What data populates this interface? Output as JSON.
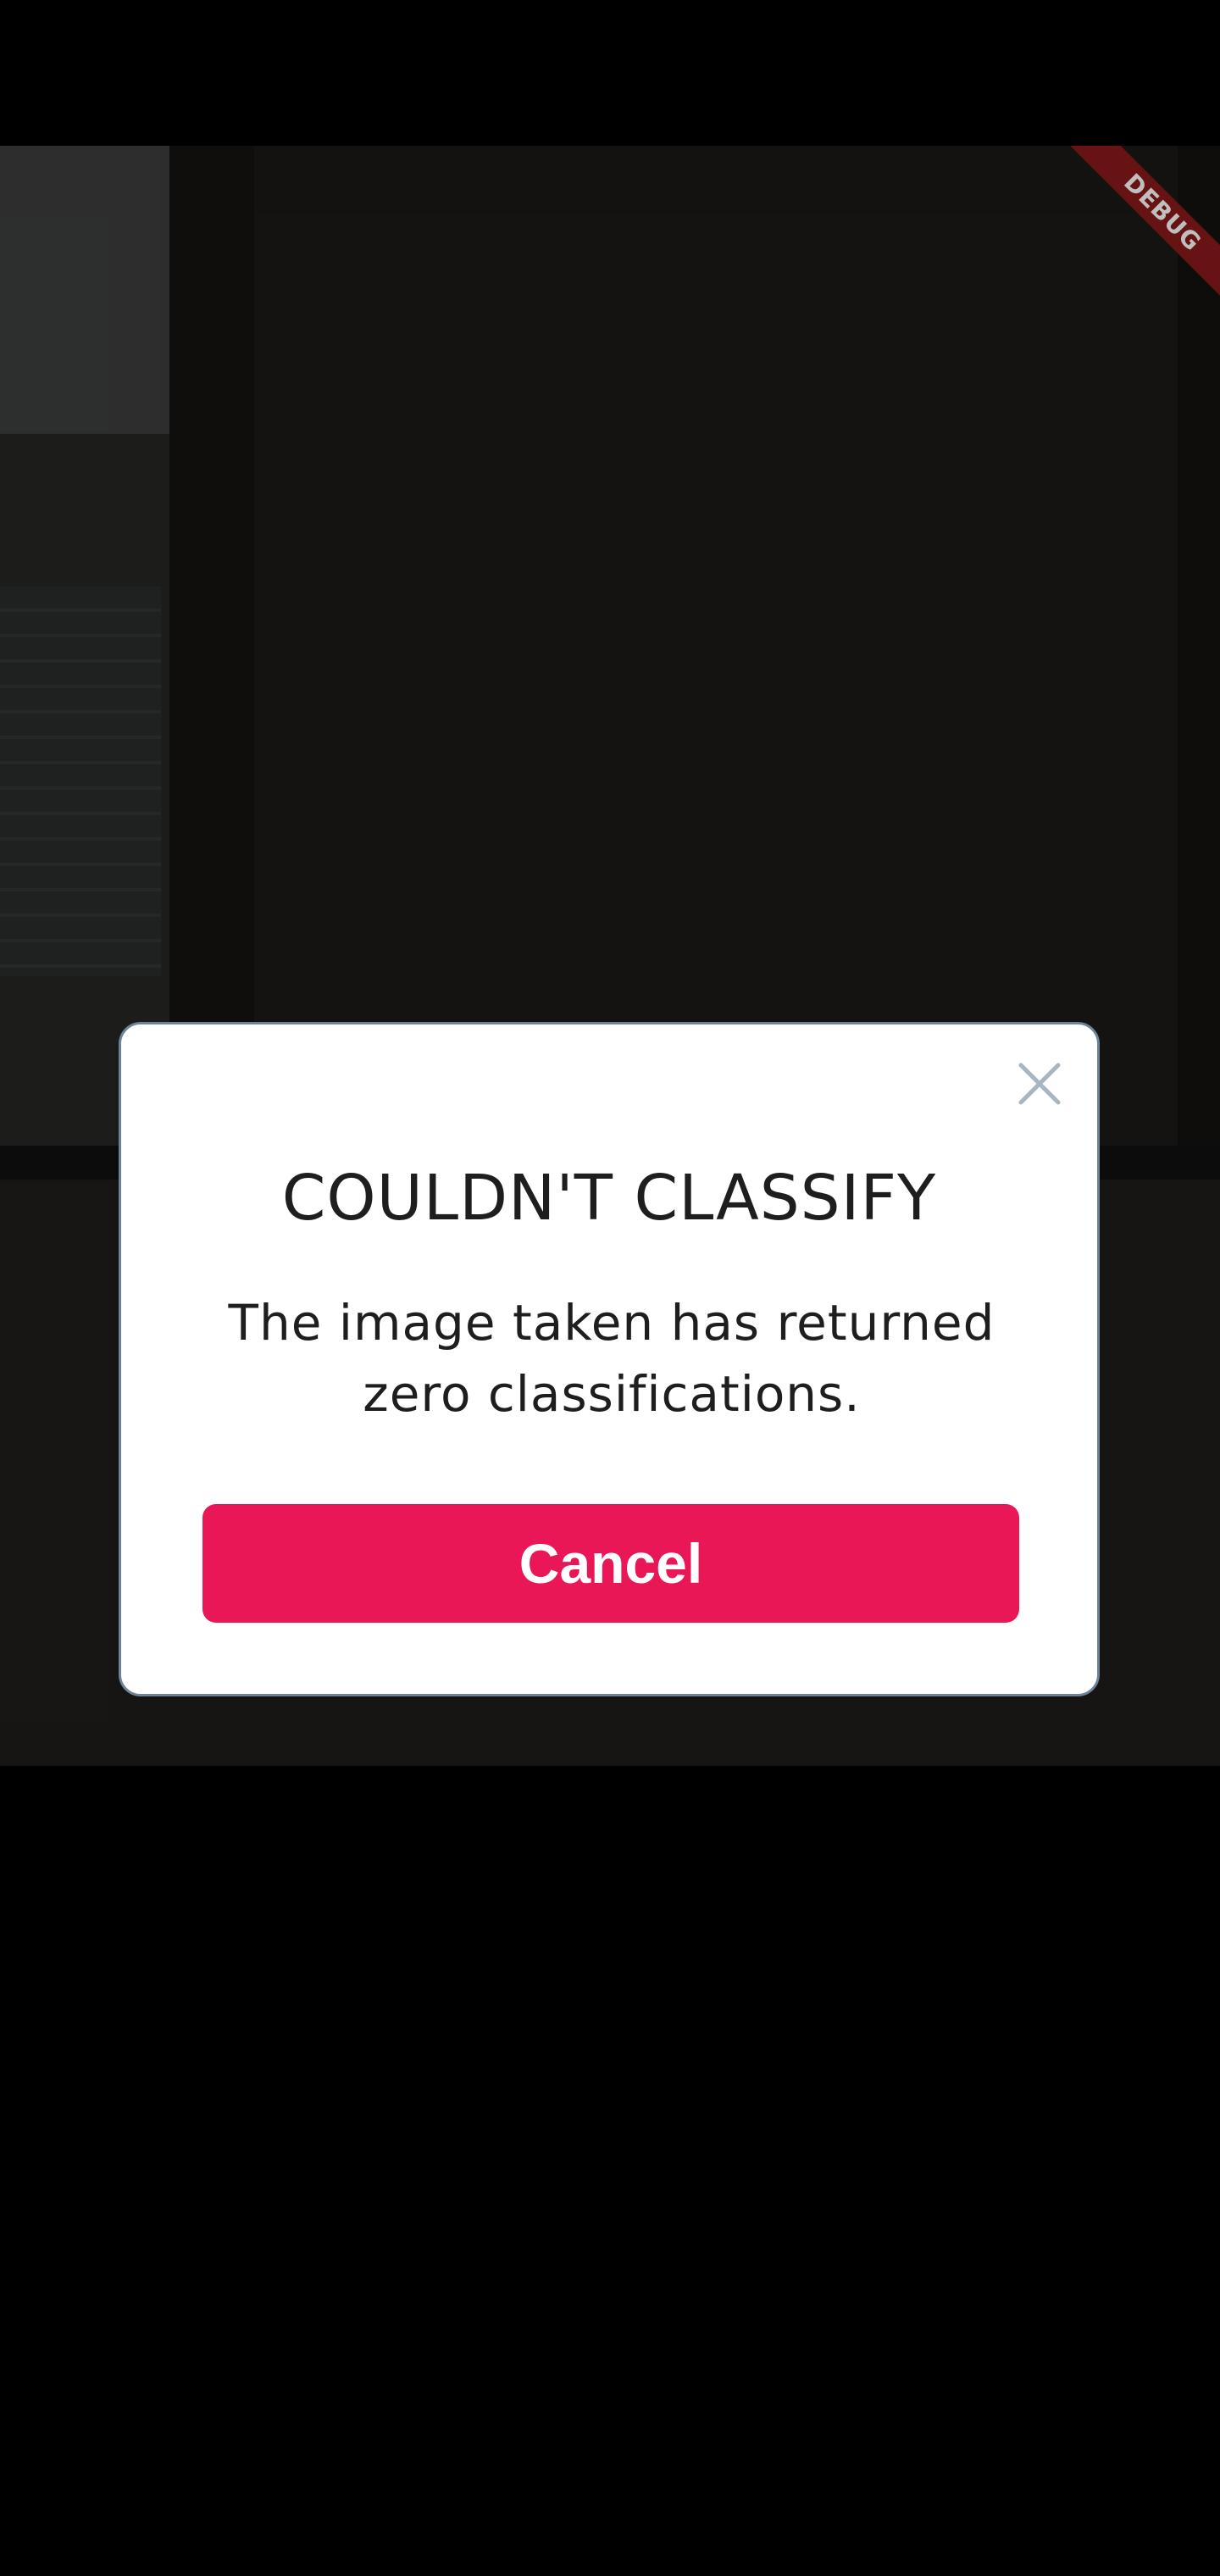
{
  "debug_banner": {
    "label": "DEBUG",
    "color": "#8b1a1a"
  },
  "dialog": {
    "title": "COULDN'T CLASSIFY",
    "message": "The image taken has returned zero classifications.",
    "close_icon": "close-icon",
    "cancel_label": "Cancel",
    "accent_color": "#ea1756",
    "border_color": "#6e8496"
  }
}
